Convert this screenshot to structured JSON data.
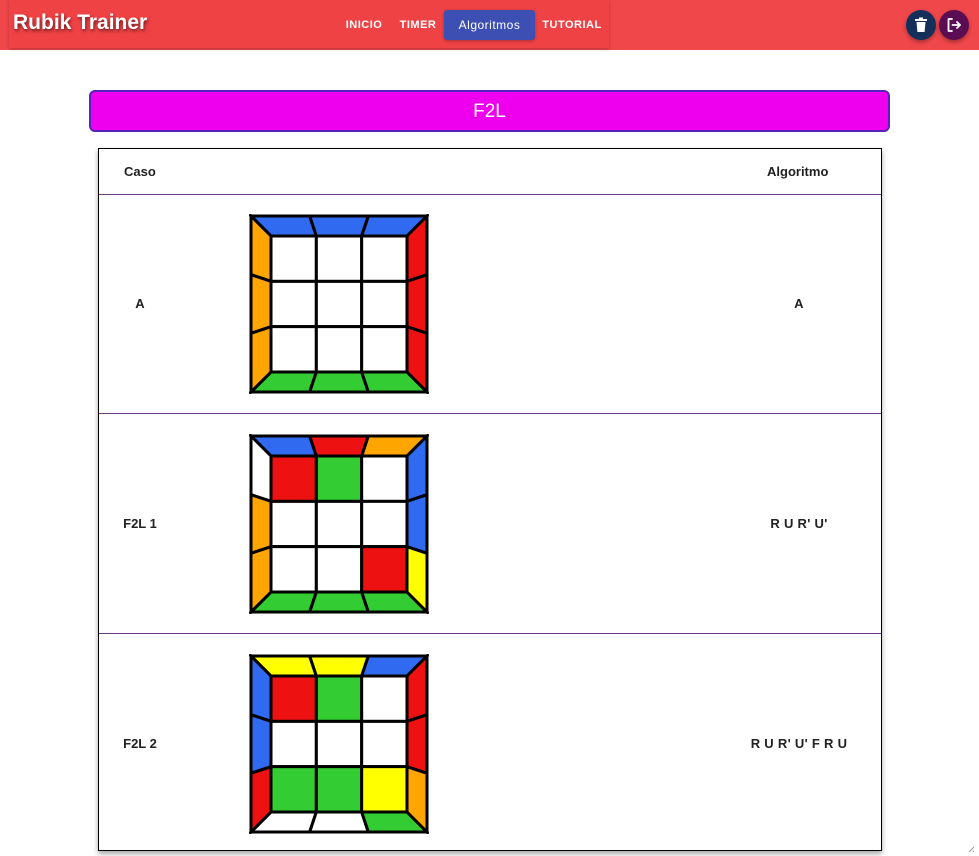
{
  "app": {
    "title": "Rubik Trainer"
  },
  "nav": [
    {
      "label": "INICIO",
      "active": false
    },
    {
      "label": "TIMER",
      "active": false
    },
    {
      "label": "Algoritmos",
      "active": true
    },
    {
      "label": "TUTORIAL",
      "active": false
    }
  ],
  "actions": {
    "delete_icon": "trash-icon",
    "logout_icon": "logout-icon"
  },
  "section": {
    "title": "F2L"
  },
  "table": {
    "headers": {
      "case": "Caso",
      "algorithm": "Algoritmo"
    },
    "rows": [
      {
        "case": "A",
        "algorithm": "A",
        "cube": {
          "top": [
            "#2f6af0",
            "#2f6af0",
            "#2f6af0"
          ],
          "left": [
            "#ffa500",
            "#ffa500",
            "#ffa500"
          ],
          "right": [
            "#ee1111",
            "#ee1111",
            "#ee1111"
          ],
          "bottom": [
            "#33cc33",
            "#33cc33",
            "#33cc33"
          ],
          "center": [
            "#ffffff",
            "#ffffff",
            "#ffffff",
            "#ffffff",
            "#ffffff",
            "#ffffff",
            "#ffffff",
            "#ffffff",
            "#ffffff"
          ]
        }
      },
      {
        "case": "F2L 1",
        "algorithm": "R U R' U'",
        "cube": {
          "top": [
            "#2f6af0",
            "#ee1111",
            "#ffa500"
          ],
          "left": [
            "#ffffff",
            "#ffa500",
            "#ffa500"
          ],
          "right": [
            "#2f6af0",
            "#2f6af0",
            "#ffff00"
          ],
          "bottom": [
            "#33cc33",
            "#33cc33",
            "#33cc33"
          ],
          "center": [
            "#ee1111",
            "#33cc33",
            "#ffffff",
            "#ffffff",
            "#ffffff",
            "#ffffff",
            "#ffffff",
            "#ffffff",
            "#ee1111"
          ]
        }
      },
      {
        "case": "F2L 2",
        "algorithm": "R U R' U' F R U",
        "cube": {
          "top": [
            "#ffff00",
            "#ffff00",
            "#2f6af0"
          ],
          "left": [
            "#2f6af0",
            "#2f6af0",
            "#ee1111"
          ],
          "right": [
            "#ee1111",
            "#ee1111",
            "#ffa500"
          ],
          "bottom": [
            "#ffffff",
            "#ffffff",
            "#33cc33"
          ],
          "center": [
            "#ee1111",
            "#33cc33",
            "#ffffff",
            "#ffffff",
            "#ffffff",
            "#ffffff",
            "#33cc33",
            "#33cc33",
            "#ffff00"
          ]
        }
      }
    ]
  },
  "colors": {
    "header_bg": "#ef4245",
    "nav_active_bg": "#3d4fb3",
    "section_bg": "#ee00ee",
    "delete_button_bg": "#14305a",
    "logout_button_bg": "#5a0d52"
  }
}
